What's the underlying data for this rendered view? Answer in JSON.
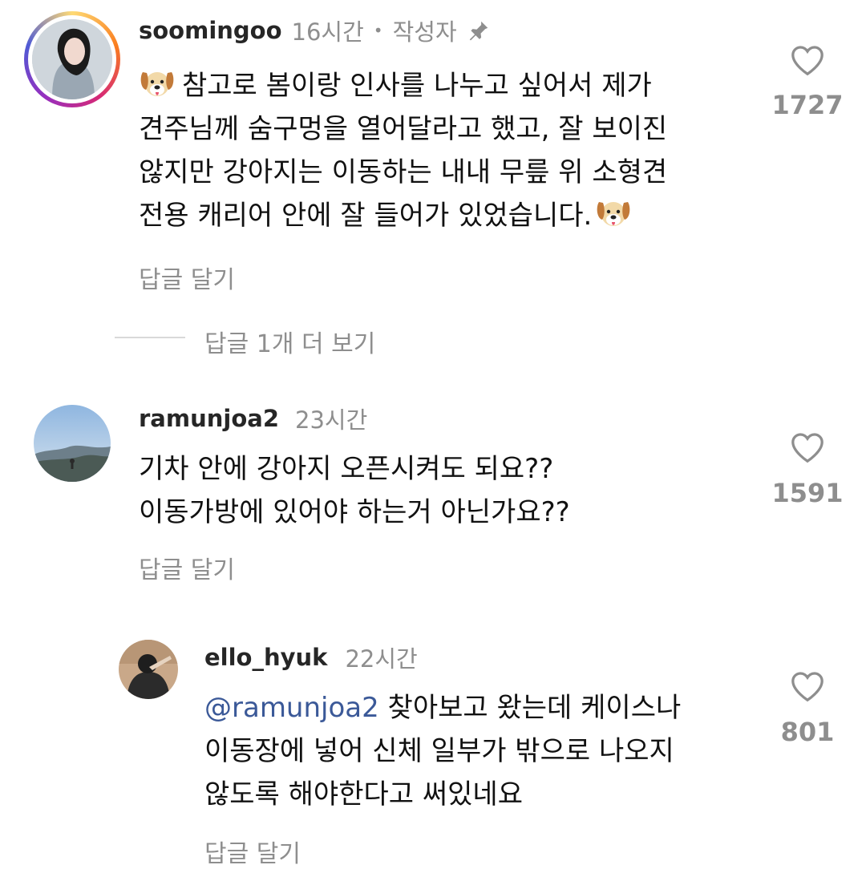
{
  "comments": [
    {
      "username": "soomingoo",
      "time": "16시간",
      "dot": "•",
      "author_badge": "작성자",
      "pinned_icon": "pin-icon",
      "emoji_icon": "dog-face-icon",
      "lines": [
        "참고로 봄이랑 인사를 나누고 싶어서 제가",
        "견주님께 숨구멍을 열어달라고 했고, 잘 보이진",
        "않지만 강아지는 이동하는 내내 무릎 위 소형견",
        "전용 캐리어 안에 잘 들어가 있었습니다."
      ],
      "likes": "1727",
      "reply_label": "답글 달기",
      "view_replies": "답글 1개 더 보기"
    },
    {
      "username": "ramunjoa2",
      "time": "23시간",
      "lines": [
        "기차  안에 강아지 오픈시켜도 되요??",
        "이동가방에 있어야 하는거 아닌가요??"
      ],
      "likes": "1591",
      "reply_label": "답글 달기"
    },
    {
      "username": "ello_hyuk",
      "time": "22시간",
      "mention": "@ramunjoa2",
      "lines": [
        " 찾아보고 왔는데 케이스나",
        "이동장에 넣어 신체 일부가 밖으로 나오지",
        "않도록 해야한다고 써있네요"
      ],
      "likes": "801",
      "reply_label": "답글 달기"
    }
  ],
  "colors": {
    "text": "#111111",
    "muted": "#8e8e8e",
    "mention": "#3b5998"
  }
}
